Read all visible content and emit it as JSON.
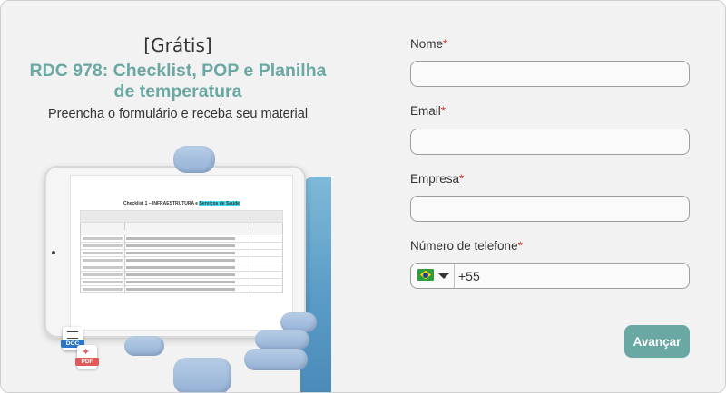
{
  "left": {
    "tag": "[Grátis]",
    "headline": "RDC 978: Checklist, POP e Planilha de temperatura",
    "subtitle": "Preencha o formulário e receba seu material",
    "document_preview": {
      "title_prefix": "Checklist 1 – INFRAESTRUTURA e ",
      "title_highlight": "Serviços de Saúde"
    },
    "file_badges": [
      {
        "icon": "doc-file-icon",
        "label": "DOC",
        "color": "#2a76c8"
      },
      {
        "icon": "pdf-file-icon",
        "label": "PDF",
        "color": "#e05a5a"
      }
    ]
  },
  "form": {
    "fields": [
      {
        "label": "Nome",
        "required_mark": "*",
        "value": ""
      },
      {
        "label": "Email",
        "required_mark": "*",
        "value": ""
      },
      {
        "label": "Empresa",
        "required_mark": "*",
        "value": ""
      }
    ],
    "phone": {
      "label": "Número de telefone",
      "required_mark": "*",
      "country_flag": "brazil-flag-icon",
      "value": "+55"
    },
    "submit_label": "Avançar"
  },
  "colors": {
    "accent": "#6aa8a3",
    "required": "#dd3333",
    "page_bg": "#f2f2f2"
  }
}
